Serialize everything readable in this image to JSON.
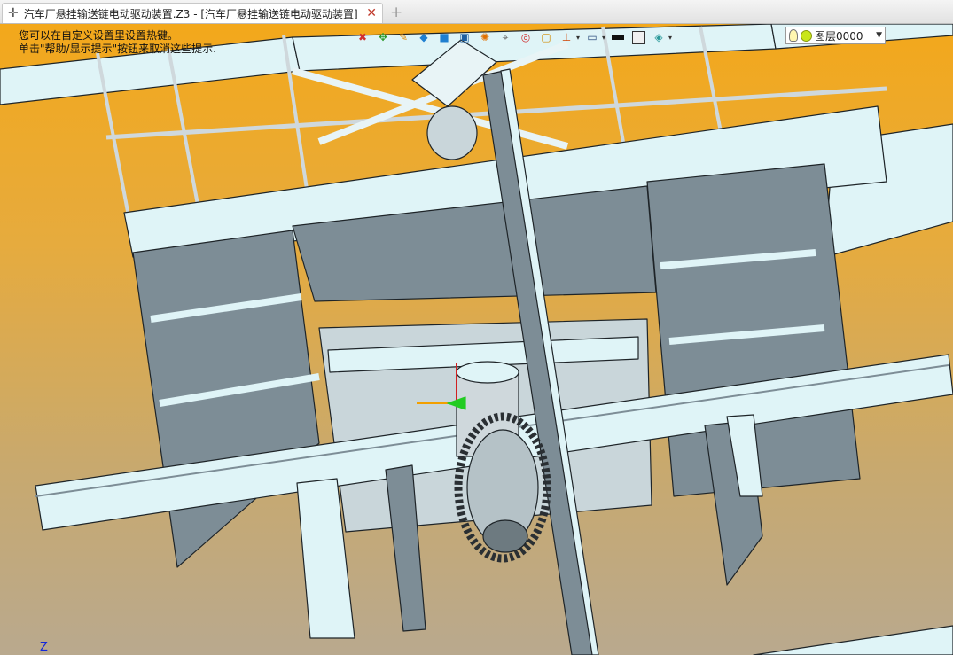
{
  "tab": {
    "title": "汽车厂悬挂输送链电动驱动装置.Z3 - [汽车厂悬挂输送链电动驱动装置]",
    "close_label": "✕",
    "new_tab_label": "+"
  },
  "hint": {
    "line1": "您可以在自定义设置里设置热键。",
    "line2": "单击\"帮助/显示提示\"按钮来取消这些提示."
  },
  "toolbar": {
    "icons": [
      "delete-icon",
      "transform-icon",
      "sketch-icon",
      "cube-icon",
      "shell-icon",
      "view-icon",
      "gear-icon",
      "measure-icon",
      "target-icon",
      "snap-icon",
      "align-icon",
      "monitor-icon",
      "line-color-icon",
      "fill-color-icon",
      "surface-icon"
    ]
  },
  "layer": {
    "label": "图层0000"
  },
  "axis": {
    "z_label": "Z"
  },
  "colors": {
    "background_top": "#f3a81b",
    "background_bottom": "#b9a98e",
    "structure_fill": "#dff4f7",
    "structure_dark": "#7d8d96",
    "structure_edge": "#1e2428"
  }
}
